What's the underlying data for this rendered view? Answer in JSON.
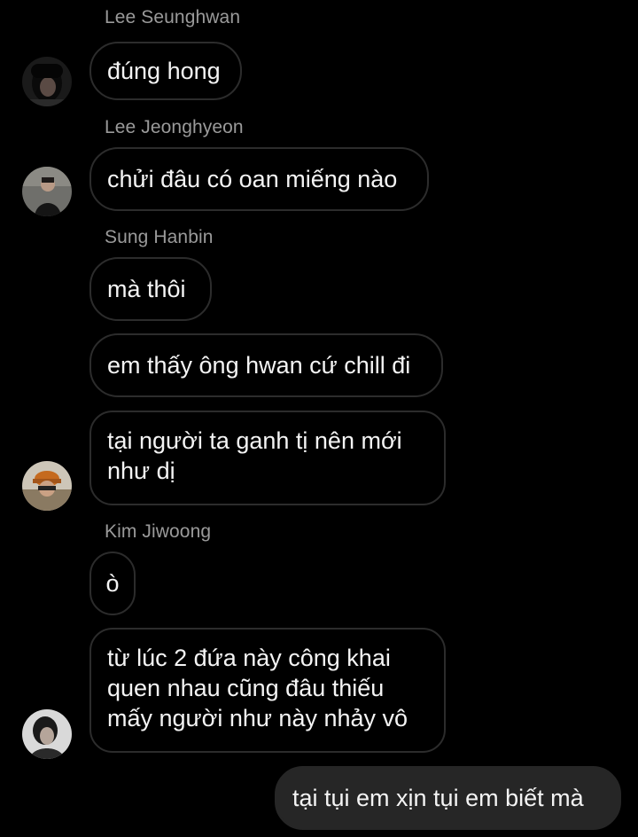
{
  "chat": {
    "messages": [
      {
        "sender": "Lee Seunghwan",
        "text": "đúng hong"
      },
      {
        "sender": "Lee Jeonghyeon",
        "text": "chửi đâu có oan miếng nào"
      },
      {
        "sender": "Sung Hanbin",
        "text": "mà thôi"
      },
      {
        "text": "em thấy ông hwan cứ chill đi"
      },
      {
        "text": "tại người ta ganh tị nên mới\nnhư dị"
      },
      {
        "sender": "Kim Jiwoong",
        "text": "ò"
      },
      {
        "text": "từ lúc 2 đứa này công khai\nquen nhau cũng đâu thiếu\nmấy người như này nhảy vô"
      },
      {
        "text": "tại tụi em xịn tụi em biết mà"
      }
    ]
  },
  "colors": {
    "background": "#000000",
    "incoming_bubble_border": "#2c2c2c",
    "outgoing_bubble": "#262626",
    "sender_name": "#9a9a9a",
    "message_text": "#f4f4f4"
  }
}
